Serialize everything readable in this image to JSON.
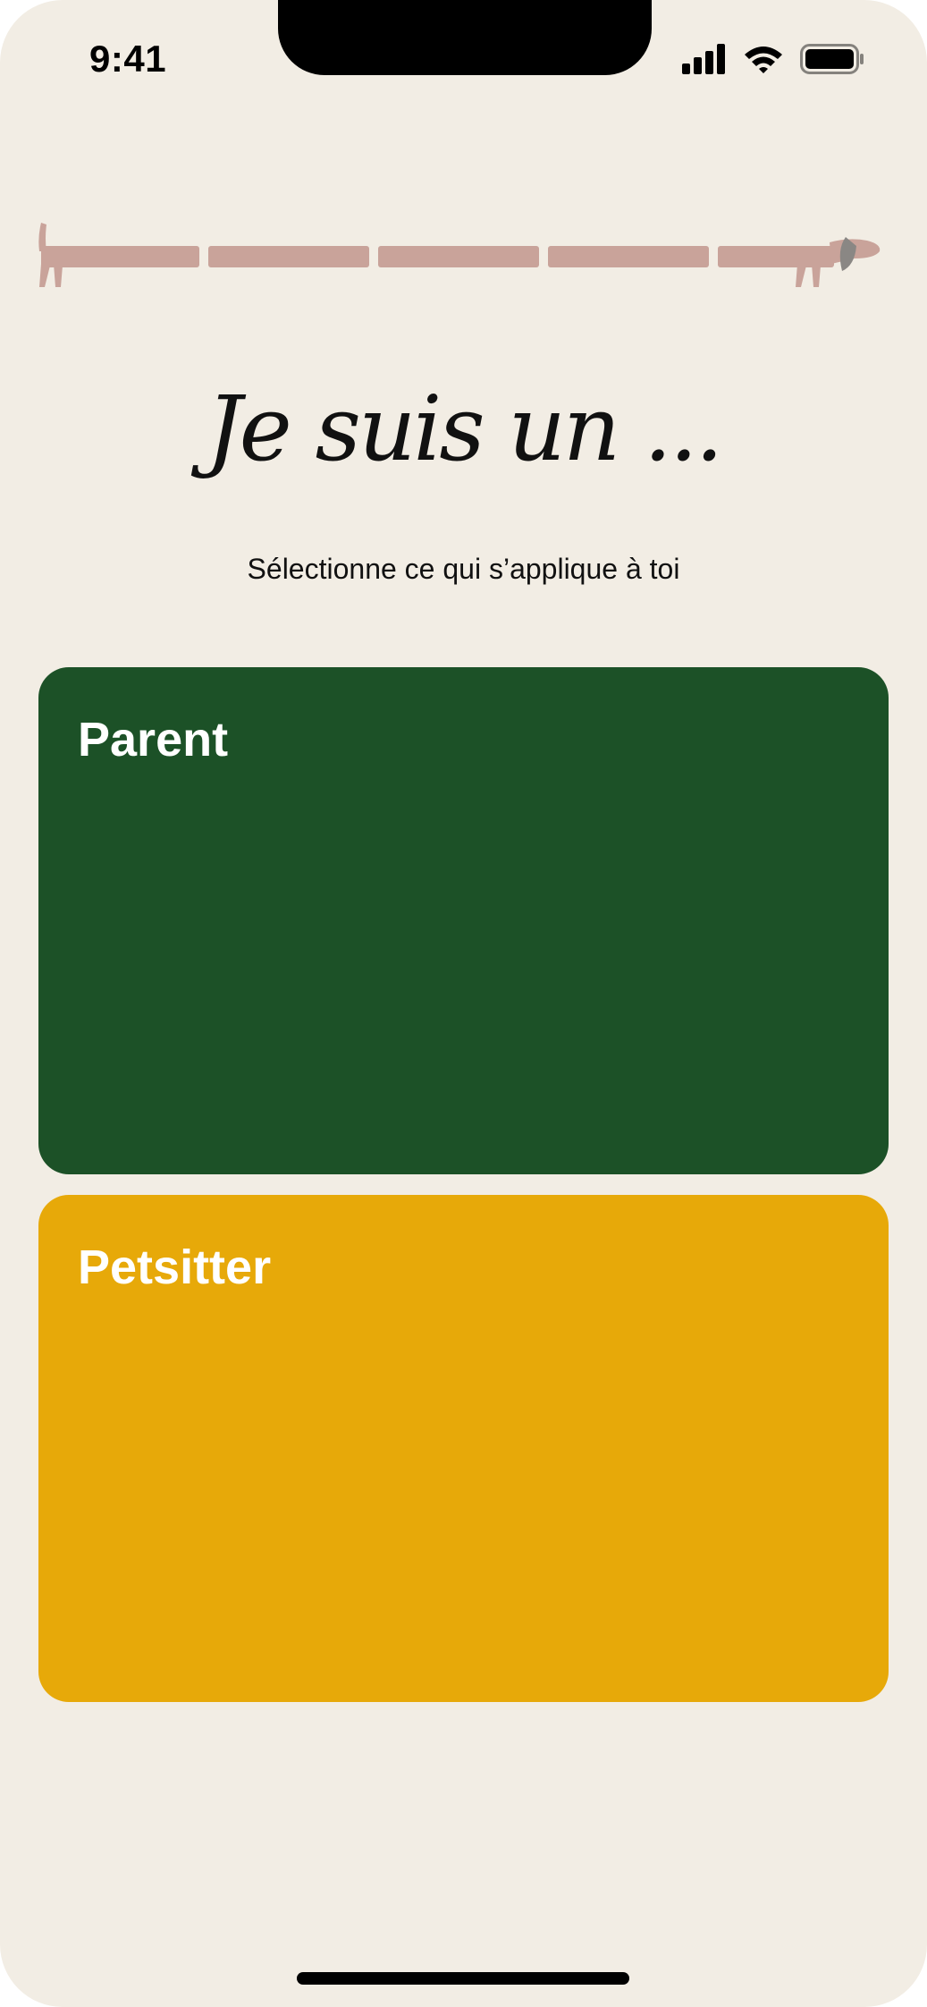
{
  "status_bar": {
    "time": "9:41",
    "icons": [
      "signal-icon",
      "wifi-icon",
      "battery-icon"
    ]
  },
  "progress": {
    "segments_total": 5,
    "icon": "dachshund-icon",
    "color": "#c9a39a"
  },
  "title": "Je suis un ...",
  "subtitle": "Sélectionne ce qui s’applique à toi",
  "options": [
    {
      "label": "Parent",
      "color": "#1c5127"
    },
    {
      "label": "Petsitter",
      "color": "#e7a909"
    }
  ],
  "colors": {
    "background": "#f2ede4",
    "text": "#111111"
  }
}
